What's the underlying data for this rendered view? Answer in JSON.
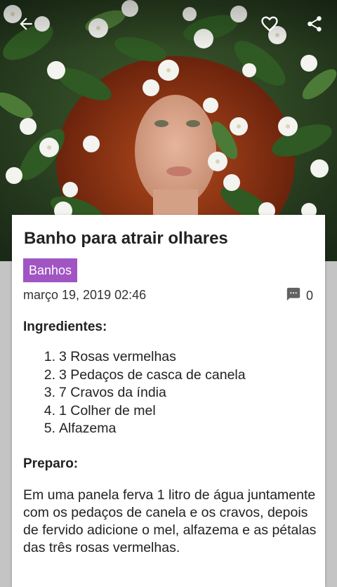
{
  "header": {
    "back_icon": "arrow-left-icon",
    "favorite_icon": "heart-outline-icon",
    "share_icon": "share-icon"
  },
  "post": {
    "title": "Banho para atrair olhares",
    "category": "Banhos",
    "date": "março 19, 2019 02:46",
    "comments_icon": "comment-icon",
    "comment_count": "0",
    "ingredients_heading": "Ingredientes:",
    "ingredients": [
      {
        "num": "1.",
        "text": "3 Rosas vermelhas"
      },
      {
        "num": "2.",
        "text": "3 Pedaços de casca de canela"
      },
      {
        "num": "3.",
        "text": "7 Cravos da índia"
      },
      {
        "num": "4.",
        "text": "1 Colher de mel"
      },
      {
        "num": "5.",
        "text": "Alfazema"
      }
    ],
    "preparation_heading": "Preparo:",
    "preparation_text": "Em uma panela ferva 1 litro de água juntamente com os pedaços de canela e os cravos, depois de fervido adicione o mel, alfazema e as pétalas das três rosas vermelhas."
  },
  "colors": {
    "tag_background": "#a055c2",
    "page_background": "#c4c4c4"
  }
}
